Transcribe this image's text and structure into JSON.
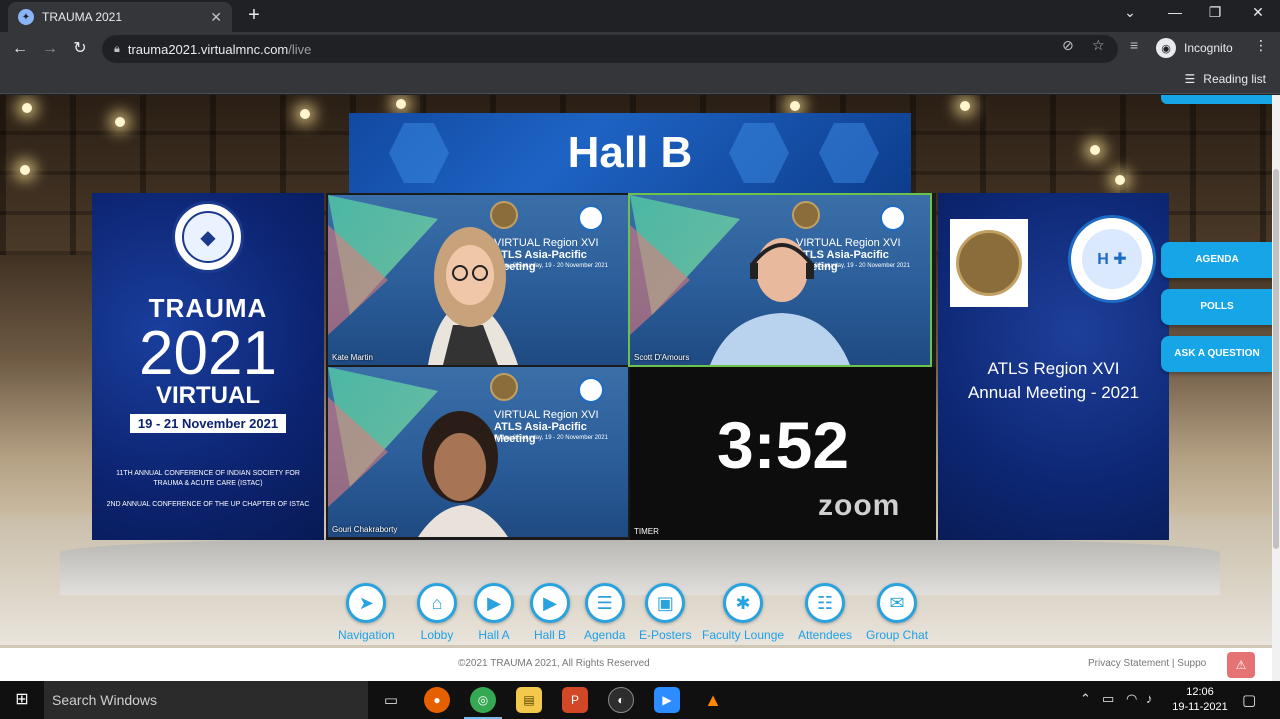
{
  "browser": {
    "tab_title": "TRAUMA 2021",
    "tab_close": "✕",
    "new_tab": "+",
    "url_domain": "trauma2021.virtualmnc.com",
    "url_path": "/live",
    "profile_label": "Incognito",
    "reading_list": "Reading list",
    "window_minimize": "—",
    "window_restore": "❐",
    "window_close": "✕",
    "window_dropdown": "⌄"
  },
  "hall": {
    "title": "Hall B"
  },
  "left_panel": {
    "line1": "TRAUMA",
    "line2": "2021",
    "line3": "VIRTUAL",
    "dates": "19 - 21 November 2021",
    "conf1": "11TH ANNUAL CONFERENCE OF INDIAN SOCIETY FOR TRAUMA & ACUTE CARE (ISTAC)",
    "conf2": "2ND ANNUAL CONFERENCE OF THE UP CHAPTER OF ISTAC"
  },
  "video_tiles": [
    {
      "name": "Kate Martin",
      "event1": "VIRTUAL Region XVI",
      "event2": "ATLS Asia-Pacific Meeting",
      "event3": "Friday & Saturday, 19 - 20 November 2021"
    },
    {
      "name": "Scott D'Amours",
      "event1": "VIRTUAL Region XVI",
      "event2": "ATLS Asia-Pacific Meeting",
      "event3": "Friday & Saturday, 19 - 20 November 2021"
    },
    {
      "name": "Gouri Chakraborty",
      "event1": "VIRTUAL Region XVI",
      "event2": "ATLS Asia-Pacific Meeting",
      "event3": "Friday & Saturday, 19 - 20 November 2021"
    }
  ],
  "timer": {
    "time": "3:52",
    "brand": "zoom",
    "label": "TIMER"
  },
  "right_panel": {
    "line1": "ATLS Region XVI",
    "line2": "Annual Meeting - 2021"
  },
  "side_buttons": {
    "agenda": "AGENDA",
    "polls": "POLLS",
    "ask": "ASK A QUESTION"
  },
  "bottom_nav": [
    {
      "label": "Navigation",
      "icon": "➤"
    },
    {
      "label": "Lobby",
      "icon": "⌂"
    },
    {
      "label": "Hall A",
      "icon": "▶"
    },
    {
      "label": "Hall B",
      "icon": "▶"
    },
    {
      "label": "Agenda",
      "icon": "☰"
    },
    {
      "label": "E-Posters",
      "icon": "▣"
    },
    {
      "label": "Faculty Lounge",
      "icon": "✱"
    },
    {
      "label": "Attendees",
      "icon": "☷"
    },
    {
      "label": "Group Chat",
      "icon": "✉"
    }
  ],
  "footer": {
    "copyright": "©2021 TRAUMA 2021, All Rights Reserved",
    "links": "Privacy Statement | Suppo",
    "alert_icon": "⚠"
  },
  "taskbar": {
    "search": "Search Windows",
    "time": "12:06",
    "date": "19-11-2021"
  },
  "colors": {
    "accent": "#16a6e8",
    "nav_label": "#1ea0e6",
    "panel_blue": "#0c2370",
    "active_speaker": "#6cc24a"
  }
}
